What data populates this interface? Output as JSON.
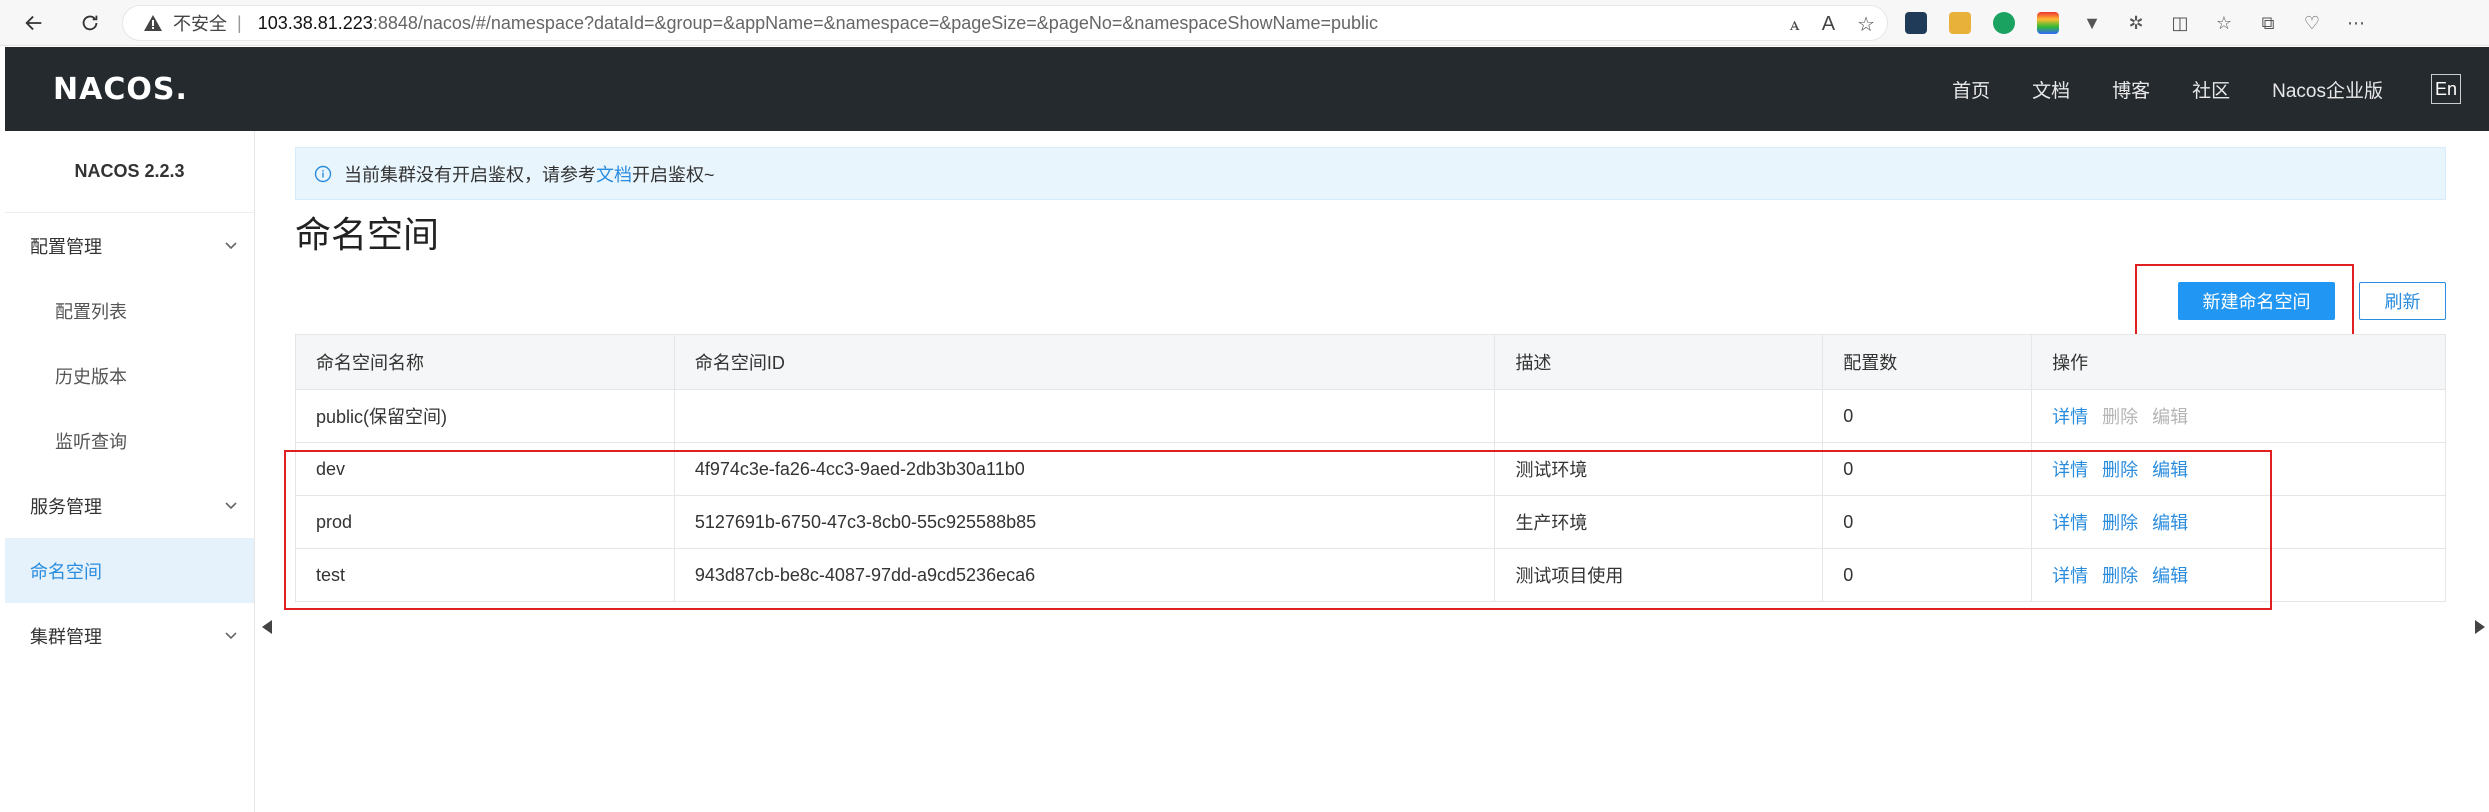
{
  "browser": {
    "insecure_label": "不安全",
    "separator": "|",
    "url_host": "103.38.81.223",
    "url_rest": ":8848/nacos/#/namespace?dataId=&group=&appName=&namespace=&pageSize=&pageNo=&namespaceShowName=public"
  },
  "header": {
    "logo": "NACOS.",
    "nav": [
      "首页",
      "文档",
      "博客",
      "社区",
      "Nacos企业版"
    ],
    "lang": "En"
  },
  "sidebar": {
    "title": "NACOS 2.2.3",
    "groups": [
      {
        "label": "配置管理",
        "items": [
          "配置列表",
          "历史版本",
          "监听查询"
        ]
      },
      {
        "label": "服务管理",
        "items": []
      },
      {
        "label": "命名空间",
        "active": true
      },
      {
        "label": "集群管理",
        "items": []
      }
    ]
  },
  "notice": {
    "text_before": "当前集群没有开启鉴权，请参考",
    "link": "文档",
    "text_after": "开启鉴权~"
  },
  "page_title": "命名空间",
  "buttons": {
    "create": "新建命名空间",
    "refresh": "刷新"
  },
  "table": {
    "columns": [
      "命名空间名称",
      "命名空间ID",
      "描述",
      "配置数",
      "操作"
    ],
    "actions": [
      "详情",
      "删除",
      "编辑"
    ],
    "rows": [
      {
        "name": "public(保留空间)",
        "id": "",
        "desc": "",
        "count": "0",
        "editable": false
      },
      {
        "name": "dev",
        "id": "4f974c3e-fa26-4cc3-9aed-2db3b30a11b0",
        "desc": "测试环境",
        "count": "0",
        "editable": true
      },
      {
        "name": "prod",
        "id": "5127691b-6750-47c3-8cb0-55c925588b85",
        "desc": "生产环境",
        "count": "0",
        "editable": true
      },
      {
        "name": "test",
        "id": "943d87cb-be8c-4087-97dd-a9cd5236eca6",
        "desc": "测试项目使用",
        "count": "0",
        "editable": true
      }
    ]
  },
  "colors": {
    "header_bg": "#252a2f",
    "primary": "#2196f3",
    "link": "#2a8cde",
    "highlight": "#e02020",
    "active_bg": "#e6f2fb"
  }
}
